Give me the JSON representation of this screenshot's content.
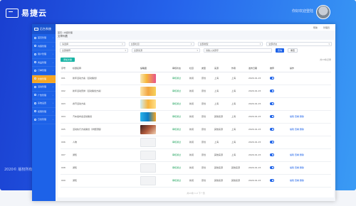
{
  "app": {
    "brand": "易捷云",
    "user_text": "你好欢迎登陆",
    "footer_text": "2020© 版权所有"
  },
  "sidebar": {
    "logo_text": "后台系统",
    "items": [
      {
        "label": "首页管理"
      },
      {
        "label": "内容管理"
      },
      {
        "label": "用户管理"
      },
      {
        "label": "商品管理"
      },
      {
        "label": "订单管理"
      },
      {
        "label": "文章管理"
      },
      {
        "label": "活动管理"
      },
      {
        "label": "广告管理"
      },
      {
        "label": "系统设置"
      },
      {
        "label": "权限管理"
      },
      {
        "label": "日志管理"
      }
    ],
    "active_index": 5
  },
  "topbar": {
    "help": "帮助",
    "account": "管理员"
  },
  "breadcrumb": {
    "path": "首页 / 内容管理",
    "title": "文章列表"
  },
  "filters": {
    "row1": [
      "请选择",
      "全部栏目",
      "全部类型",
      "全部状态"
    ],
    "row2": [
      "全部推荐",
      "全部来源",
      "请输入关键字"
    ],
    "search_btn": "查询",
    "reset_btn": "重置"
  },
  "table": {
    "add_label": "添加文章",
    "count_text": "共13条记录",
    "headers": [
      "序号",
      "标题名称",
      "缩略图",
      "审核状态",
      "栏目",
      "类型",
      "来源",
      "作者",
      "发布日期",
      "推荐",
      "操作"
    ],
    "rows": [
      {
        "no": "001",
        "title": "新年活动方案（活动策划）",
        "thumb": "t0",
        "status": "审核通过",
        "col": "新闻",
        "type": "原创",
        "src": "上海",
        "author": "上海",
        "date": "2020-01-15",
        "ops": ""
      },
      {
        "no": "002",
        "title": "新年活动安排（活动策划方案）",
        "thumb": "t1",
        "status": "审核通过",
        "col": "新闻",
        "type": "原创",
        "src": "上海",
        "author": "上海",
        "date": "2020-01-15",
        "ops": ""
      },
      {
        "no": "003",
        "title": "春节活动方案",
        "thumb": "t2",
        "status": "审核通过",
        "col": "新闻",
        "type": "原创",
        "src": "上海",
        "author": "上海",
        "date": "2020-01-15",
        "ops": ""
      },
      {
        "no": "004",
        "title": "汽车发布会活动策划",
        "thumb": "t3",
        "status": "审核通过",
        "col": "新闻",
        "type": "原创",
        "src": "其他来源",
        "author": "上海",
        "date": "2020-01-15",
        "ops": "编辑 查看 删除"
      },
      {
        "no": "005",
        "title": "活动执行方案策划（详细流程）",
        "thumb": "t4",
        "status": "审核通过",
        "col": "新闻",
        "type": "原创",
        "src": "其他来源",
        "author": "上海",
        "date": "2020-01-15",
        "ops": "编辑 查看 删除"
      },
      {
        "no": "006",
        "title": "人物",
        "thumb": "blank",
        "status": "审核通过",
        "col": "新闻",
        "type": "原创",
        "src": "上海",
        "author": "上海",
        "date": "2020-01-15",
        "ops": ""
      },
      {
        "no": "007",
        "title": "通知",
        "thumb": "blank",
        "status": "审核通过",
        "col": "新闻",
        "type": "原创",
        "src": "其他来源",
        "author": "上海",
        "date": "2020-01-15",
        "ops": "编辑 查看 删除"
      },
      {
        "no": "008",
        "title": "通知",
        "thumb": "blank",
        "status": "审核通过",
        "col": "新闻",
        "type": "原创",
        "src": "其他来源",
        "author": "其他来源",
        "date": "2020-01-15",
        "ops": "编辑 查看 删除"
      },
      {
        "no": "009",
        "title": "通知",
        "thumb": "blank",
        "status": "审核通过",
        "col": "新闻",
        "type": "原创",
        "src": "其他来源",
        "author": "其他来源",
        "date": "2020-01-15",
        "ops": "编辑 查看 删除"
      }
    ],
    "pager_text": "共13条 1 2 下一页"
  }
}
